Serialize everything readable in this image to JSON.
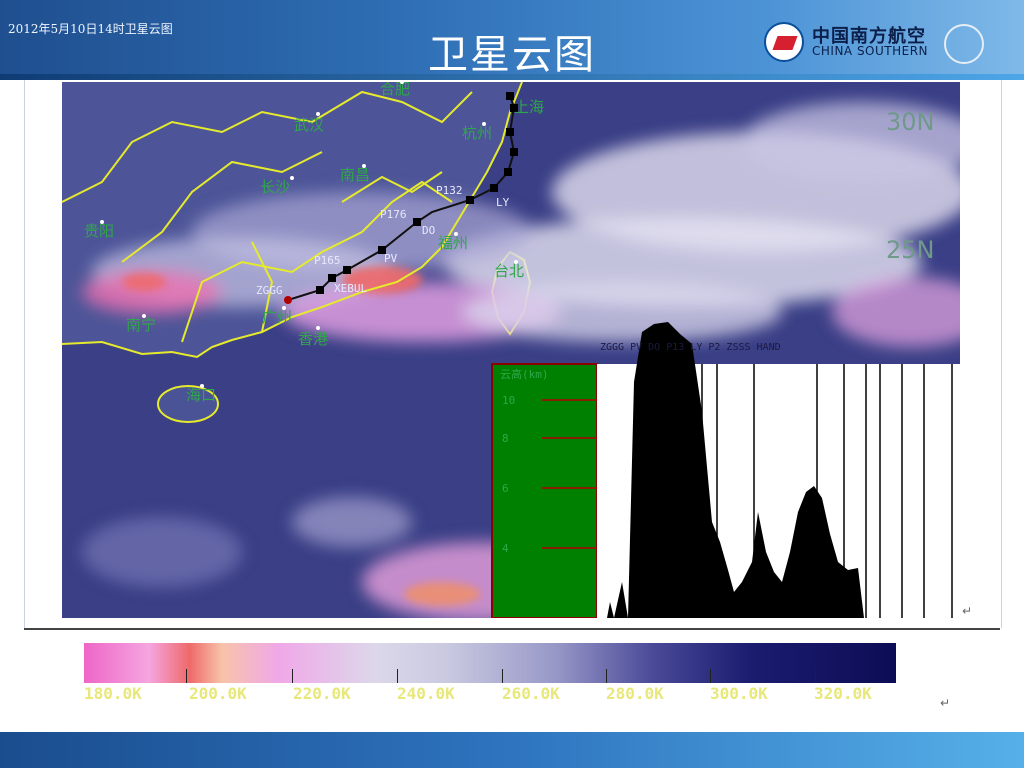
{
  "header": {
    "date_caption": "2012年5月10日14时卫星云图",
    "title": "卫星云图",
    "logo_cn": "中国南方航空",
    "logo_en": "CHINA SOUTHERN"
  },
  "map": {
    "lat_labels": [
      "30N",
      "25N"
    ],
    "places": [
      "长沙",
      "南昌",
      "福州",
      "台北",
      "广州",
      "香港",
      "海口",
      "南宁",
      "贵阳",
      "武汉",
      "杭州",
      "合肥",
      "上海"
    ],
    "waypoints": [
      "P132",
      "P176",
      "P165",
      "PV",
      "XEBUL",
      "ZGGG",
      "DO",
      "LY"
    ],
    "profile_header": "ZGGG  PV  DO  P13  LY  P2  ZSSS  HAND",
    "profile_axis_title": "云高(km)",
    "profile_ticks": [
      "10",
      "8",
      "6",
      "4"
    ]
  },
  "colors": {
    "ocean": "#3a3f86",
    "land": "#4d5598",
    "coast": "#e6ea2c",
    "route": "#111111",
    "profile_panel": "#008000"
  },
  "scale": {
    "labels": [
      "180.0K",
      "200.0K",
      "220.0K",
      "240.0K",
      "260.0K",
      "280.0K",
      "300.0K",
      "320.0K"
    ],
    "return_mark": "↵"
  }
}
